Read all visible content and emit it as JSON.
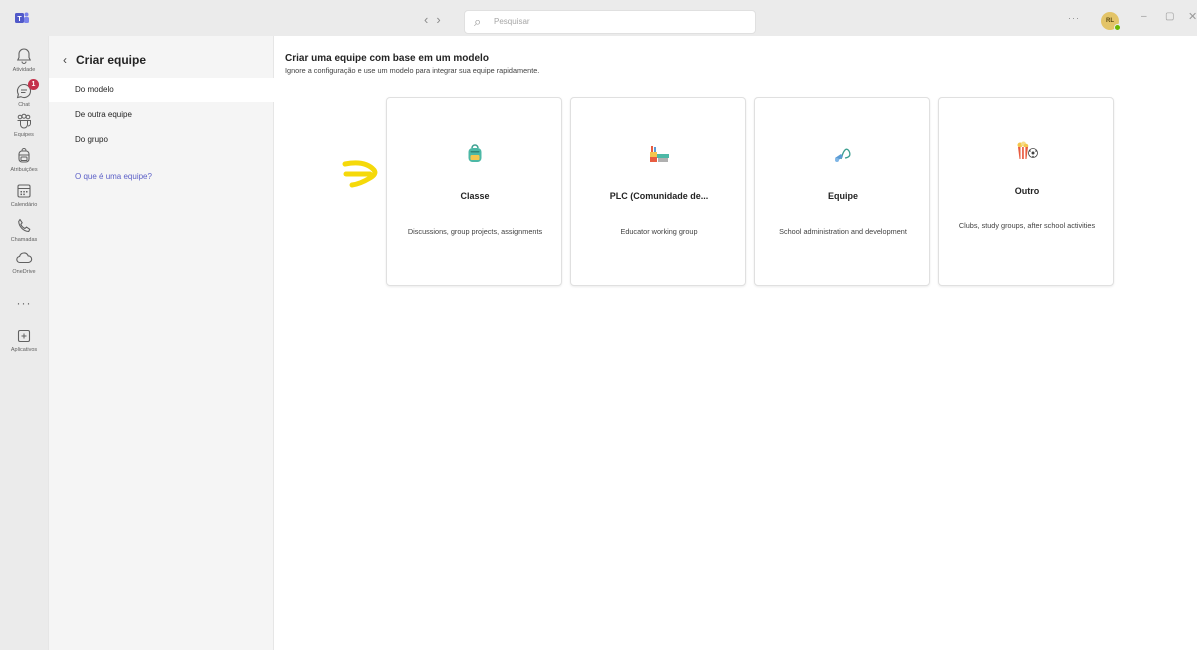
{
  "titlebar": {
    "search_placeholder": "Pesquisar",
    "more": "···",
    "avatar_initials": "RL",
    "minimize": "–",
    "maximize": "▢",
    "close": "✕"
  },
  "rail": {
    "items": [
      {
        "label": "Atividade",
        "icon": "bell-icon"
      },
      {
        "label": "Chat",
        "icon": "chat-icon",
        "badge": "1"
      },
      {
        "label": "Equipes",
        "icon": "teams-icon"
      },
      {
        "label": "Atribuições",
        "icon": "backpack-icon"
      },
      {
        "label": "Calendário",
        "icon": "calendar-icon"
      },
      {
        "label": "Chamadas",
        "icon": "phone-icon"
      },
      {
        "label": "OneDrive",
        "icon": "cloud-icon"
      },
      {
        "label": "Aplicativos",
        "icon": "apps-icon"
      }
    ],
    "more": "···"
  },
  "panel": {
    "title": "Criar equipe",
    "items": [
      {
        "label": "Do modelo",
        "selected": true
      },
      {
        "label": "De outra equipe",
        "selected": false
      },
      {
        "label": "Do grupo",
        "selected": false
      }
    ],
    "link": "O que é uma equipe?"
  },
  "main": {
    "title": "Criar uma equipe com base em um modelo",
    "subtitle": "Ignore a configuração e use um modelo para integrar sua equipe rapidamente.",
    "cards": [
      {
        "title": "Classe",
        "description": "Discussions, group projects, assignments",
        "icon": "backpack-icon"
      },
      {
        "title": "PLC (Comunidade de...",
        "description": "Educator working group",
        "icon": "books-icon"
      },
      {
        "title": "Equipe",
        "description": "School administration and development",
        "icon": "whistle-icon"
      },
      {
        "title": "Outro",
        "description": "Clubs, study groups, after school activities",
        "icon": "popcorn-soccer-icon"
      }
    ]
  },
  "colors": {
    "accent": "#5b5fc7",
    "annotation_arrow": "#f5d90a",
    "badge": "#c4314b"
  }
}
